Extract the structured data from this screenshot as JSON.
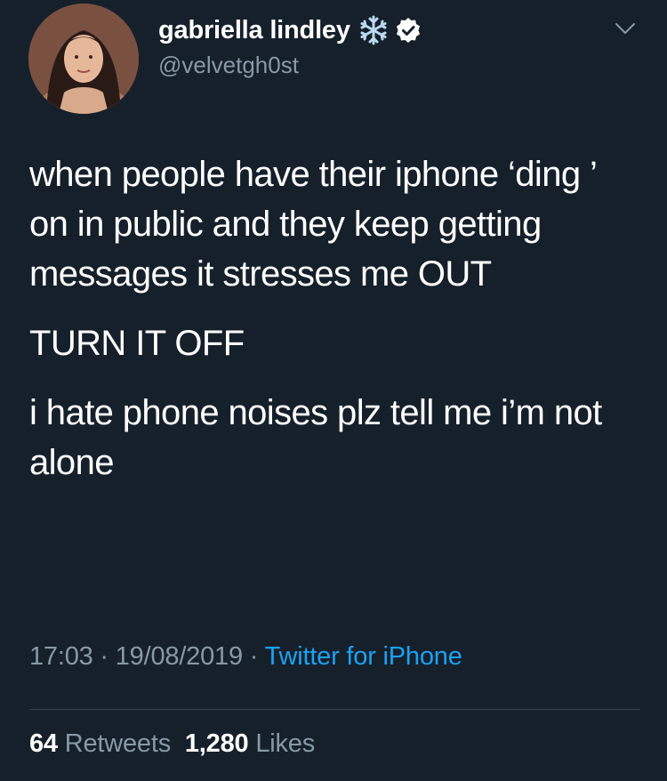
{
  "author": {
    "display_name": "gabriella lindley",
    "handle": "@velvetgh0st",
    "avatar_icon": "profile-photo",
    "name_emoji": "snowflake-icon",
    "verified_badge": "verified-badge-icon"
  },
  "menu_icon": "chevron-down-icon",
  "tweet": {
    "paragraphs": [
      "when people have their iphone ‘ding ’ on in public and they keep getting messages it stresses me OUT",
      "TURN IT OFF",
      "i hate phone noises plz tell me i’m not alone"
    ]
  },
  "meta": {
    "time": "17:03",
    "separator1": " · ",
    "date": "19/08/2019",
    "separator2": " · ",
    "source": "Twitter for iPhone"
  },
  "stats": {
    "retweets_count": "64",
    "retweets_label": "Retweets",
    "likes_count": "1,280",
    "likes_label": "Likes"
  },
  "colors": {
    "background": "#15202b",
    "text": "#ffffff",
    "secondary_text": "#8899a6",
    "link": "#1da1f2",
    "divider": "#38444d"
  }
}
